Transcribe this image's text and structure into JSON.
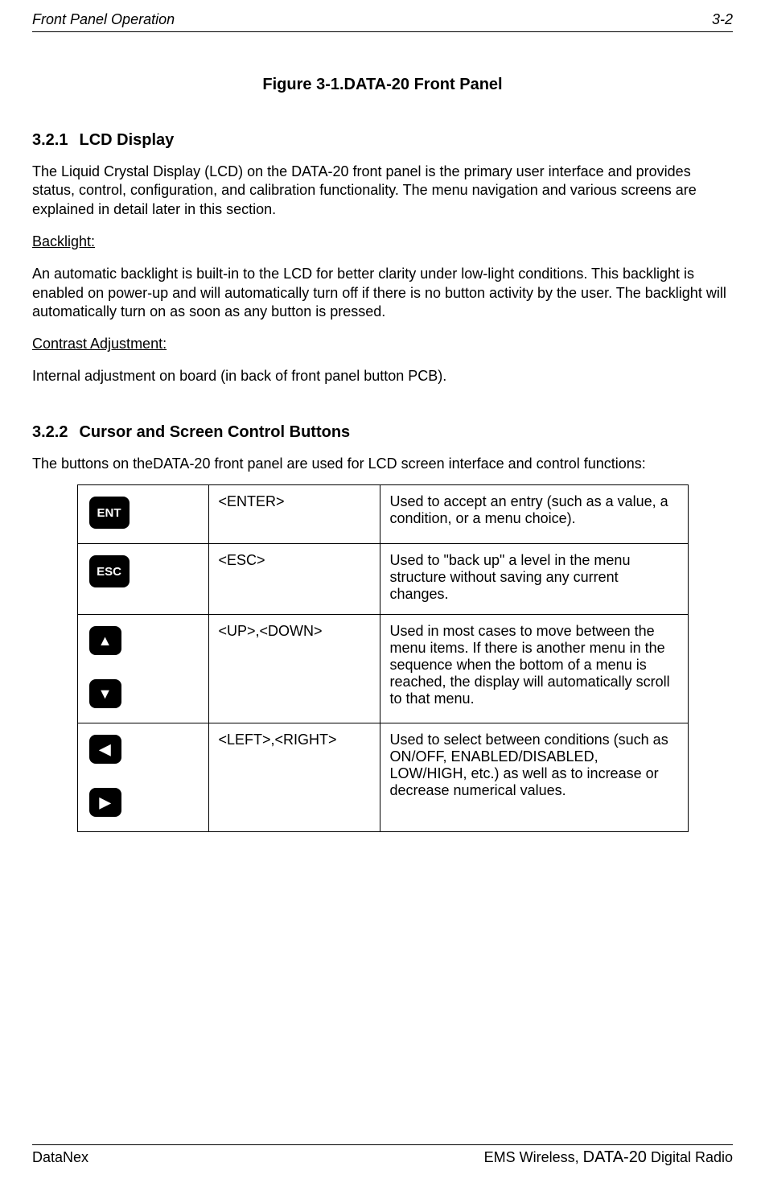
{
  "header": {
    "left": "Front Panel Operation",
    "right": "3-2"
  },
  "figure_title": "Figure 3-1.DATA-20 Front Panel",
  "section1": {
    "num": "3.2.1",
    "title": "LCD Display",
    "p1": "The Liquid Crystal Display (LCD) on the DATA-20 front panel is the primary user interface and provides status, control, configuration, and calibration functionality.  The menu navigation and various screens are explained in detail later in this section.",
    "backlight_label": "Backlight:",
    "backlight_text": "An automatic backlight is built-in to the LCD for better clarity under low-light conditions.  This backlight is enabled on power-up and will automatically turn off if there is no button activity by the user.  The backlight will automatically turn on as soon as any button is pressed.",
    "contrast_label": "Contrast Adjustment:",
    "contrast_text": "Internal adjustment on board (in back of front panel button PCB)."
  },
  "section2": {
    "num": "3.2.2",
    "title": "Cursor and Screen Control Buttons",
    "intro": "The buttons on theDATA-20 front panel are used for LCD screen interface and control functions:",
    "rows": [
      {
        "icon_label": "ENT",
        "name": "<ENTER>",
        "desc": "Used to accept an entry (such as a value, a condition, or a menu choice)."
      },
      {
        "icon_label": "ESC",
        "name": "<ESC>",
        "desc": "Used to \"back up\" a level in the menu structure without saving any current changes."
      },
      {
        "icon_label": "▲▼",
        "name": "<UP>,<DOWN>",
        "desc": "Used in most cases to move between the menu items. If there is another menu in the sequence when the bottom of a menu is reached, the display will automatically scroll to that menu."
      },
      {
        "icon_label": "◄►",
        "name": "<LEFT>,<RIGHT>",
        "desc": "Used to select between conditions (such as ON/OFF, ENABLED/DISABLED, LOW/HIGH, etc.) as well as to increase or decrease numerical values."
      }
    ]
  },
  "footer": {
    "left": "DataNex",
    "right_prefix": "EMS Wireless, ",
    "right_model": "DATA-20",
    "right_suffix": " Digital Radio"
  },
  "icons": {
    "up": "▲",
    "down": "▼",
    "left": "◀",
    "right": "▶"
  }
}
